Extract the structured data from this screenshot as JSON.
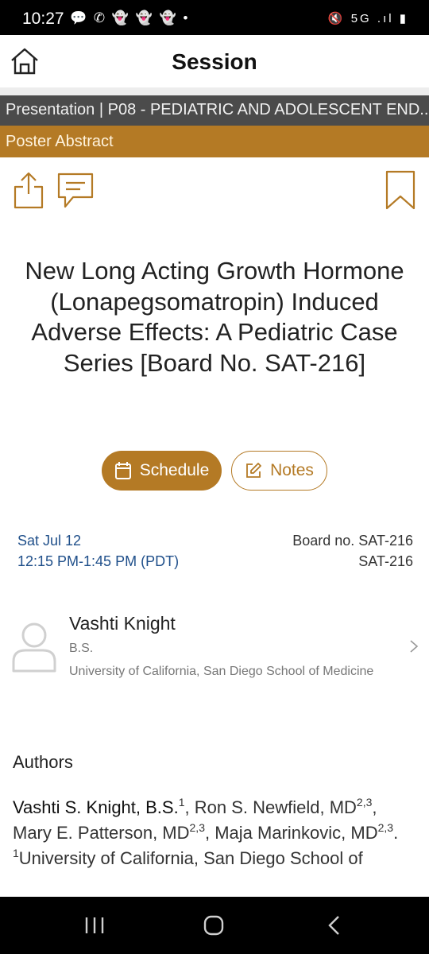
{
  "status_bar": {
    "time": "10:27",
    "left_icons": "💬 ✆ 👻 👻 👻 •",
    "right_icons": "🔇 5G .ıl ▮"
  },
  "app_bar": {
    "title": "Session"
  },
  "breadcrumb": {
    "text": "Presentation | P08 - PEDIATRIC AND ADOLESCENT END..."
  },
  "category": {
    "label": "Poster Abstract"
  },
  "abstract": {
    "title": "New Long Acting Growth Hormone (Lonapegsomatropin) Induced Adverse Effects: A Pediatric Case Series [Board No. SAT-216]"
  },
  "buttons": {
    "schedule": "Schedule",
    "notes": "Notes"
  },
  "session": {
    "date": "Sat Jul 12",
    "time": "12:15 PM-1:45 PM (PDT)",
    "board_label": "Board no. SAT-216",
    "board_code": "SAT-216"
  },
  "presenter": {
    "name": "Vashti Knight",
    "degree": "B.S.",
    "institution": "University of California, San Diego School of Medicine"
  },
  "authors": {
    "heading": "Authors",
    "list": [
      {
        "name": "Vashti S. Knight, B.S.",
        "sup": "1",
        "sep": ", "
      },
      {
        "name": "Ron S. Newfield, MD",
        "sup": "2,3",
        "sep": ", "
      },
      {
        "name": "Mary E. Patterson, MD",
        "sup": "2,3",
        "sep": ", "
      },
      {
        "name": "Maja Marinkovic, MD",
        "sup": "2,3",
        "sep": "."
      }
    ],
    "affiliation_sup": "1",
    "affiliation_text": "University of California, San Diego School of"
  },
  "colors": {
    "accent": "#b47a25",
    "breadcrumb_bg": "#4b4b4b",
    "link": "#1f4f8a"
  },
  "icons": [
    "home-icon",
    "share-icon",
    "comment-icon",
    "bookmark-icon",
    "calendar-icon",
    "edit-icon",
    "avatar-icon",
    "chevron-right-icon",
    "recents-icon",
    "home-nav-icon",
    "back-icon"
  ]
}
